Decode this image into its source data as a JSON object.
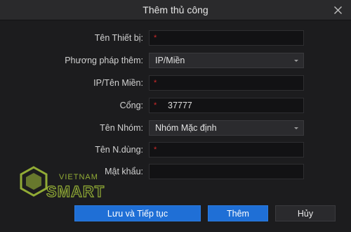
{
  "dialog": {
    "title": "Thêm thủ công",
    "close_icon": "close-icon"
  },
  "form": {
    "device_name": {
      "label": "Tên Thiết bị:",
      "value": "",
      "required_mark": "*"
    },
    "add_method": {
      "label": "Phương pháp thêm:",
      "selected": "IP/Miền"
    },
    "ip_domain": {
      "label": "IP/Tên Miền:",
      "value": "",
      "required_mark": "*"
    },
    "port": {
      "label": "Cổng:",
      "value": "37777",
      "required_mark": "*"
    },
    "group": {
      "label": "Tên Nhóm:",
      "selected": "Nhóm Mặc định"
    },
    "username": {
      "label": "Tên N.dùng:",
      "value": "",
      "required_mark": "*"
    },
    "password": {
      "label": "Mật khẩu:",
      "value": ""
    }
  },
  "buttons": {
    "save_continue": "Lưu và Tiếp tục",
    "add": "Thêm",
    "cancel": "Hủy"
  },
  "watermark": {
    "brand_top": "VIETNAM",
    "brand_main": "SMART"
  },
  "colors": {
    "primary": "#1f6fd6",
    "required": "#d02a2a",
    "background": "#1c1c1e",
    "watermark": "#a6c43a"
  }
}
